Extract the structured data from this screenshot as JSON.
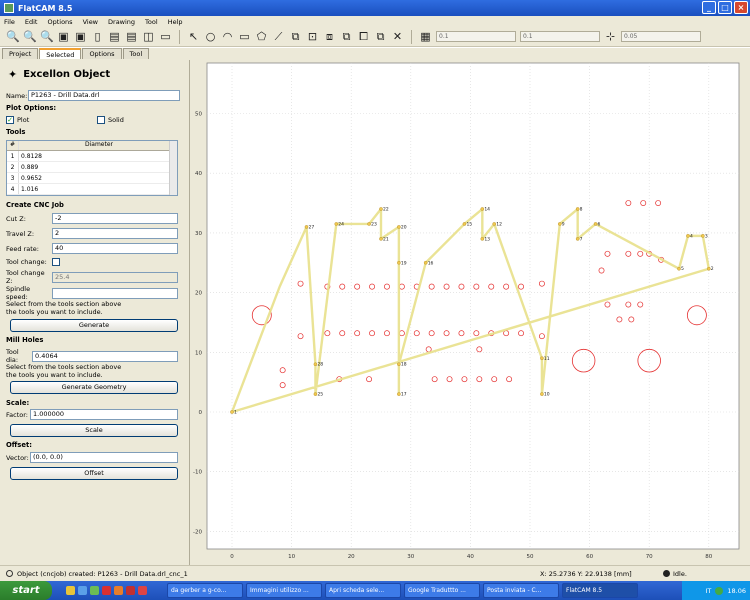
{
  "window": {
    "title": "FlatCAM 8.5"
  },
  "menu": [
    "File",
    "Edit",
    "Options",
    "View",
    "Drawing",
    "Tool",
    "Help"
  ],
  "toolbar": {
    "icons": [
      "zoom-fit-icon",
      "zoom-in-icon",
      "zoom-out-icon",
      "replot-icon",
      "clear-plot-icon",
      "new-icon",
      "open-gerber-icon",
      "open-excellon-icon",
      "open-gcode-icon",
      "shell-icon",
      "pointer-icon",
      "circle-icon",
      "arc-icon",
      "rect-icon",
      "polygon-icon",
      "path-icon",
      "union-icon",
      "cut-icon",
      "subtract-icon",
      "intersect-icon",
      "copy-icon",
      "move-icon",
      "delete-icon"
    ],
    "grid_x": "0.1",
    "grid_y": "0.1",
    "snap_max": "0.05"
  },
  "tabs": [
    "Project",
    "Selected",
    "Options",
    "Tool"
  ],
  "panel": {
    "object_title": "Excellon Object",
    "name_label": "Name:",
    "name_value": "P1263 - Drill Data.drl",
    "plot_options": "Plot Options:",
    "plot_label": "Plot",
    "solid_label": "Solid",
    "tools_header": "Tools",
    "tools_cols": [
      "#",
      "Diameter"
    ],
    "tools_rows": [
      {
        "n": "1",
        "d": "0.8128"
      },
      {
        "n": "2",
        "d": "0.889"
      },
      {
        "n": "3",
        "d": "0.9652"
      },
      {
        "n": "4",
        "d": "1.016"
      }
    ],
    "create_cnc": "Create CNC Job",
    "cutz_label": "Cut Z:",
    "cutz": "-2",
    "travelz_label": "Travel Z:",
    "travelz": "2",
    "feed_label": "Feed rate:",
    "feed": "40",
    "toolchange_label": "Tool change:",
    "toolchangez_label": "Tool change Z:",
    "toolchangez": "25.4",
    "spindle_label": "Spindle speed:",
    "spindle": "",
    "hint1": "Select from the tools section above",
    "hint2": "the tools you want to include.",
    "generate_btn": "Generate",
    "mill_holes": "Mill Holes",
    "tooldia_label": "Tool dia:",
    "tooldia": "0.4064",
    "hint3": "Select from the tools section above",
    "hint4": "the tools you want to include.",
    "gen_geom_btn": "Generate Geometry",
    "scale_header": "Scale:",
    "factor_label": "Factor:",
    "factor": "1.000000",
    "scale_btn": "Scale",
    "offset_header": "Offset:",
    "vector_label": "Vector:",
    "vector": "(0.0, 0.0)",
    "offset_btn": "Offset"
  },
  "plot": {
    "x_ticks": [
      "0",
      "10",
      "20",
      "30",
      "40",
      "50",
      "60",
      "70",
      "80"
    ],
    "y_ticks": [
      "50",
      "40",
      "30",
      "20",
      "10",
      "0",
      "-10",
      "-20"
    ],
    "path_nodes": [
      [
        0,
        0,
        "1"
      ],
      [
        8,
        21,
        ""
      ],
      [
        12.5,
        31,
        "27"
      ],
      [
        14,
        8,
        "28"
      ],
      [
        14,
        3,
        "25"
      ],
      [
        17.5,
        31.5,
        "24"
      ],
      [
        23,
        31.5,
        "23"
      ],
      [
        25,
        34,
        "22"
      ],
      [
        25,
        29,
        "21"
      ],
      [
        28,
        31,
        "20"
      ],
      [
        28,
        25,
        "19"
      ],
      [
        28,
        3,
        "17"
      ],
      [
        28,
        8,
        "18"
      ],
      [
        32.5,
        25,
        "16"
      ],
      [
        39,
        31.5,
        "15"
      ],
      [
        42,
        34,
        "14"
      ],
      [
        42,
        29,
        "13"
      ],
      [
        44,
        31.5,
        "12"
      ],
      [
        52,
        9,
        "11"
      ],
      [
        52,
        3,
        "10"
      ],
      [
        55,
        31.5,
        "9"
      ],
      [
        58,
        34,
        "8"
      ],
      [
        58,
        29,
        "7"
      ],
      [
        61,
        31.5,
        "6"
      ],
      [
        75,
        24,
        "5"
      ],
      [
        76.5,
        29.5,
        "4"
      ],
      [
        79,
        29.5,
        "3"
      ],
      [
        80,
        24,
        "2"
      ],
      [
        0,
        0,
        ""
      ]
    ],
    "holes_small": [
      [
        11.5,
        21.5
      ],
      [
        16,
        21
      ],
      [
        18.5,
        21
      ],
      [
        21,
        21
      ],
      [
        23.5,
        21
      ],
      [
        26,
        21
      ],
      [
        28.5,
        21
      ],
      [
        31,
        21
      ],
      [
        33.5,
        21
      ],
      [
        36,
        21
      ],
      [
        38.5,
        21
      ],
      [
        41,
        21
      ],
      [
        43.5,
        21
      ],
      [
        46,
        21
      ],
      [
        48.5,
        21
      ],
      [
        11.5,
        12.7
      ],
      [
        16,
        13.2
      ],
      [
        18.5,
        13.2
      ],
      [
        21,
        13.2
      ],
      [
        23.5,
        13.2
      ],
      [
        26,
        13.2
      ],
      [
        28.5,
        13.2
      ],
      [
        31,
        13.2
      ],
      [
        33.5,
        13.2
      ],
      [
        36,
        13.2
      ],
      [
        38.5,
        13.2
      ],
      [
        41,
        13.2
      ],
      [
        43.5,
        13.2
      ],
      [
        46,
        13.2
      ],
      [
        48.5,
        13.2
      ],
      [
        52,
        21.5
      ],
      [
        52,
        12.7
      ],
      [
        8.5,
        7
      ],
      [
        8.5,
        4.5
      ],
      [
        18,
        5.5
      ],
      [
        23,
        5.5
      ],
      [
        33,
        10.5
      ],
      [
        34,
        5.5
      ],
      [
        36.5,
        5.5
      ],
      [
        39,
        5.5
      ],
      [
        41.5,
        5.5
      ],
      [
        41.5,
        10.5
      ],
      [
        44,
        5.5
      ],
      [
        46.5,
        5.5
      ],
      [
        62,
        23.7
      ],
      [
        63,
        18
      ],
      [
        65,
        15.5
      ],
      [
        66.5,
        18
      ],
      [
        67,
        15.5
      ],
      [
        68.5,
        18
      ],
      [
        63,
        26.5
      ],
      [
        66.5,
        26.5
      ],
      [
        68.5,
        26.5
      ],
      [
        70,
        26.5
      ],
      [
        72,
        25.5
      ],
      [
        66.5,
        35
      ],
      [
        69,
        35
      ],
      [
        71.5,
        35
      ]
    ],
    "holes_large": [
      [
        5,
        16.2,
        1.6
      ],
      [
        59,
        8.6,
        1.9
      ],
      [
        70,
        8.6,
        1.9
      ],
      [
        78,
        16.2,
        1.6
      ]
    ]
  },
  "status": {
    "message": "Object (cncjob) created: P1263 - Drill Data.drl_cnc_1",
    "coords": "X: 25.2736   Y: 22.9138   [mm]",
    "state": "Idle."
  },
  "taskbar": {
    "start": "start",
    "tasks": [
      "da gerber a g-co...",
      "Immagini utilizzo ...",
      "Apri scheda sele...",
      "Google Traduttto ...",
      "Posta inviata - C...",
      "FlatCAM 8.5"
    ],
    "lang": "IT",
    "clock": "18.06"
  },
  "colors": {
    "path": "#e8e08a",
    "hole": "#e53030",
    "accent": "#f0a030"
  }
}
